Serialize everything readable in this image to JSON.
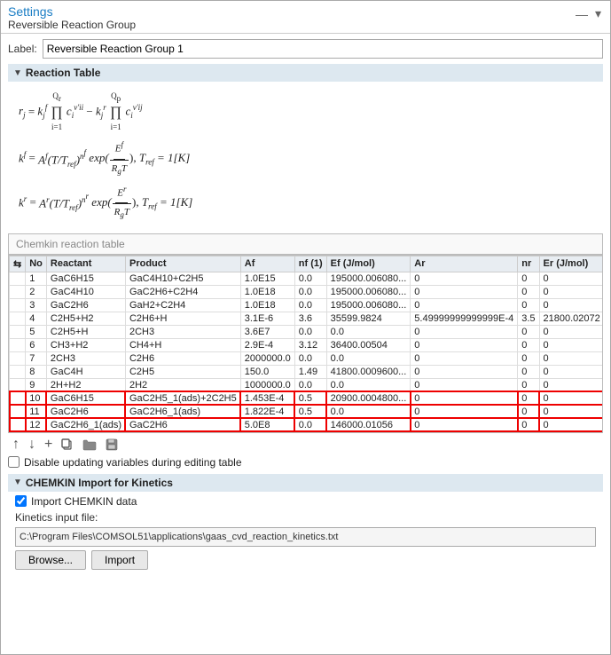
{
  "header": {
    "title": "Settings",
    "subtitle": "Reversible Reaction Group"
  },
  "label_section": {
    "label": "Label:",
    "value": "Reversible Reaction Group 1"
  },
  "reaction_table_section": {
    "title": "Reaction Table"
  },
  "chemkin_placeholder": "Chemkin reaction table",
  "table": {
    "columns": [
      "No",
      "Reactant",
      "Product",
      "Af",
      "nf (1)",
      "Ef (J/mol)",
      "Ar",
      "nr",
      "Er (J/mol)"
    ],
    "rows": [
      {
        "no": "1",
        "reactant": "GaC6H15",
        "product": "GaC4H10+C2H5",
        "af": "1.0E15",
        "nf": "0.0",
        "ef": "195000.006080...",
        "ar": "0",
        "nr": "0",
        "er": "0"
      },
      {
        "no": "2",
        "reactant": "GaC4H10",
        "product": "GaC2H6+C2H4",
        "af": "1.0E18",
        "nf": "0.0",
        "ef": "195000.006080...",
        "ar": "0",
        "nr": "0",
        "er": "0"
      },
      {
        "no": "3",
        "reactant": "GaC2H6",
        "product": "GaH2+C2H4",
        "af": "1.0E18",
        "nf": "0.0",
        "ef": "195000.006080...",
        "ar": "0",
        "nr": "0",
        "er": "0"
      },
      {
        "no": "4",
        "reactant": "C2H5+H2",
        "product": "C2H6+H",
        "af": "3.1E-6",
        "nf": "3.6",
        "ef": "35599.9824",
        "ar": "5.49999999999999E-4",
        "nr": "3.5",
        "er": "21800.02072"
      },
      {
        "no": "5",
        "reactant": "C2H5+H",
        "product": "2CH3",
        "af": "3.6E7",
        "nf": "0.0",
        "ef": "0.0",
        "ar": "0",
        "nr": "0",
        "er": "0"
      },
      {
        "no": "6",
        "reactant": "CH3+H2",
        "product": "CH4+H",
        "af": "2.9E-4",
        "nf": "3.12",
        "ef": "36400.00504",
        "ar": "0",
        "nr": "0",
        "er": "0"
      },
      {
        "no": "7",
        "reactant": "2CH3",
        "product": "C2H6",
        "af": "2000000.0",
        "nf": "0.0",
        "ef": "0.0",
        "ar": "0",
        "nr": "0",
        "er": "0"
      },
      {
        "no": "8",
        "reactant": "GaC4H",
        "product": "C2H5",
        "af": "150.0",
        "nf": "1.49",
        "ef": "41800.0009600...",
        "ar": "0",
        "nr": "0",
        "er": "0"
      },
      {
        "no": "9",
        "reactant": "2H+H2",
        "product": "2H2",
        "af": "1000000.0",
        "nf": "0.0",
        "ef": "0.0",
        "ar": "0",
        "nr": "0",
        "er": "0"
      },
      {
        "no": "10",
        "reactant": "GaC6H15",
        "product": "GaC2H5_1(ads)+2C2H5",
        "af": "1.453E-4",
        "nf": "0.5",
        "ef": "20900.0004800...",
        "ar": "0",
        "nr": "0",
        "er": "0",
        "highlight_product": true
      },
      {
        "no": "11",
        "reactant": "GaC2H6",
        "product": "GaC2H6_1(ads)",
        "af": "1.822E-4",
        "nf": "0.5",
        "ef": "0.0",
        "ar": "0",
        "nr": "0",
        "er": "0",
        "highlight_product": true
      },
      {
        "no": "12",
        "reactant": "GaC2H6_1(ads)",
        "product": "GaC2H6",
        "af": "5.0E8",
        "nf": "0.0",
        "ef": "146000.01056",
        "ar": "0",
        "nr": "0",
        "er": "0",
        "highlight_reactant": true
      }
    ]
  },
  "table_toolbar": {
    "up_label": "↑",
    "down_label": "↓",
    "add_label": "+",
    "copy_label": "⧉",
    "folder_label": "📁",
    "save_label": "💾"
  },
  "disable_checkbox": {
    "label": "Disable updating variables during editing table",
    "checked": false
  },
  "chemkin_section": {
    "title": "CHEMKIN Import for Kinetics"
  },
  "chemkin_import": {
    "checkbox_label": "Import CHEMKIN data",
    "checked": true,
    "file_label": "Kinetics input file:",
    "file_path": "C:\\Program Files\\COMSOL51\\applications\\gaas_cvd_reaction_kinetics.txt",
    "browse_label": "Browse...",
    "import_label": "Import"
  }
}
